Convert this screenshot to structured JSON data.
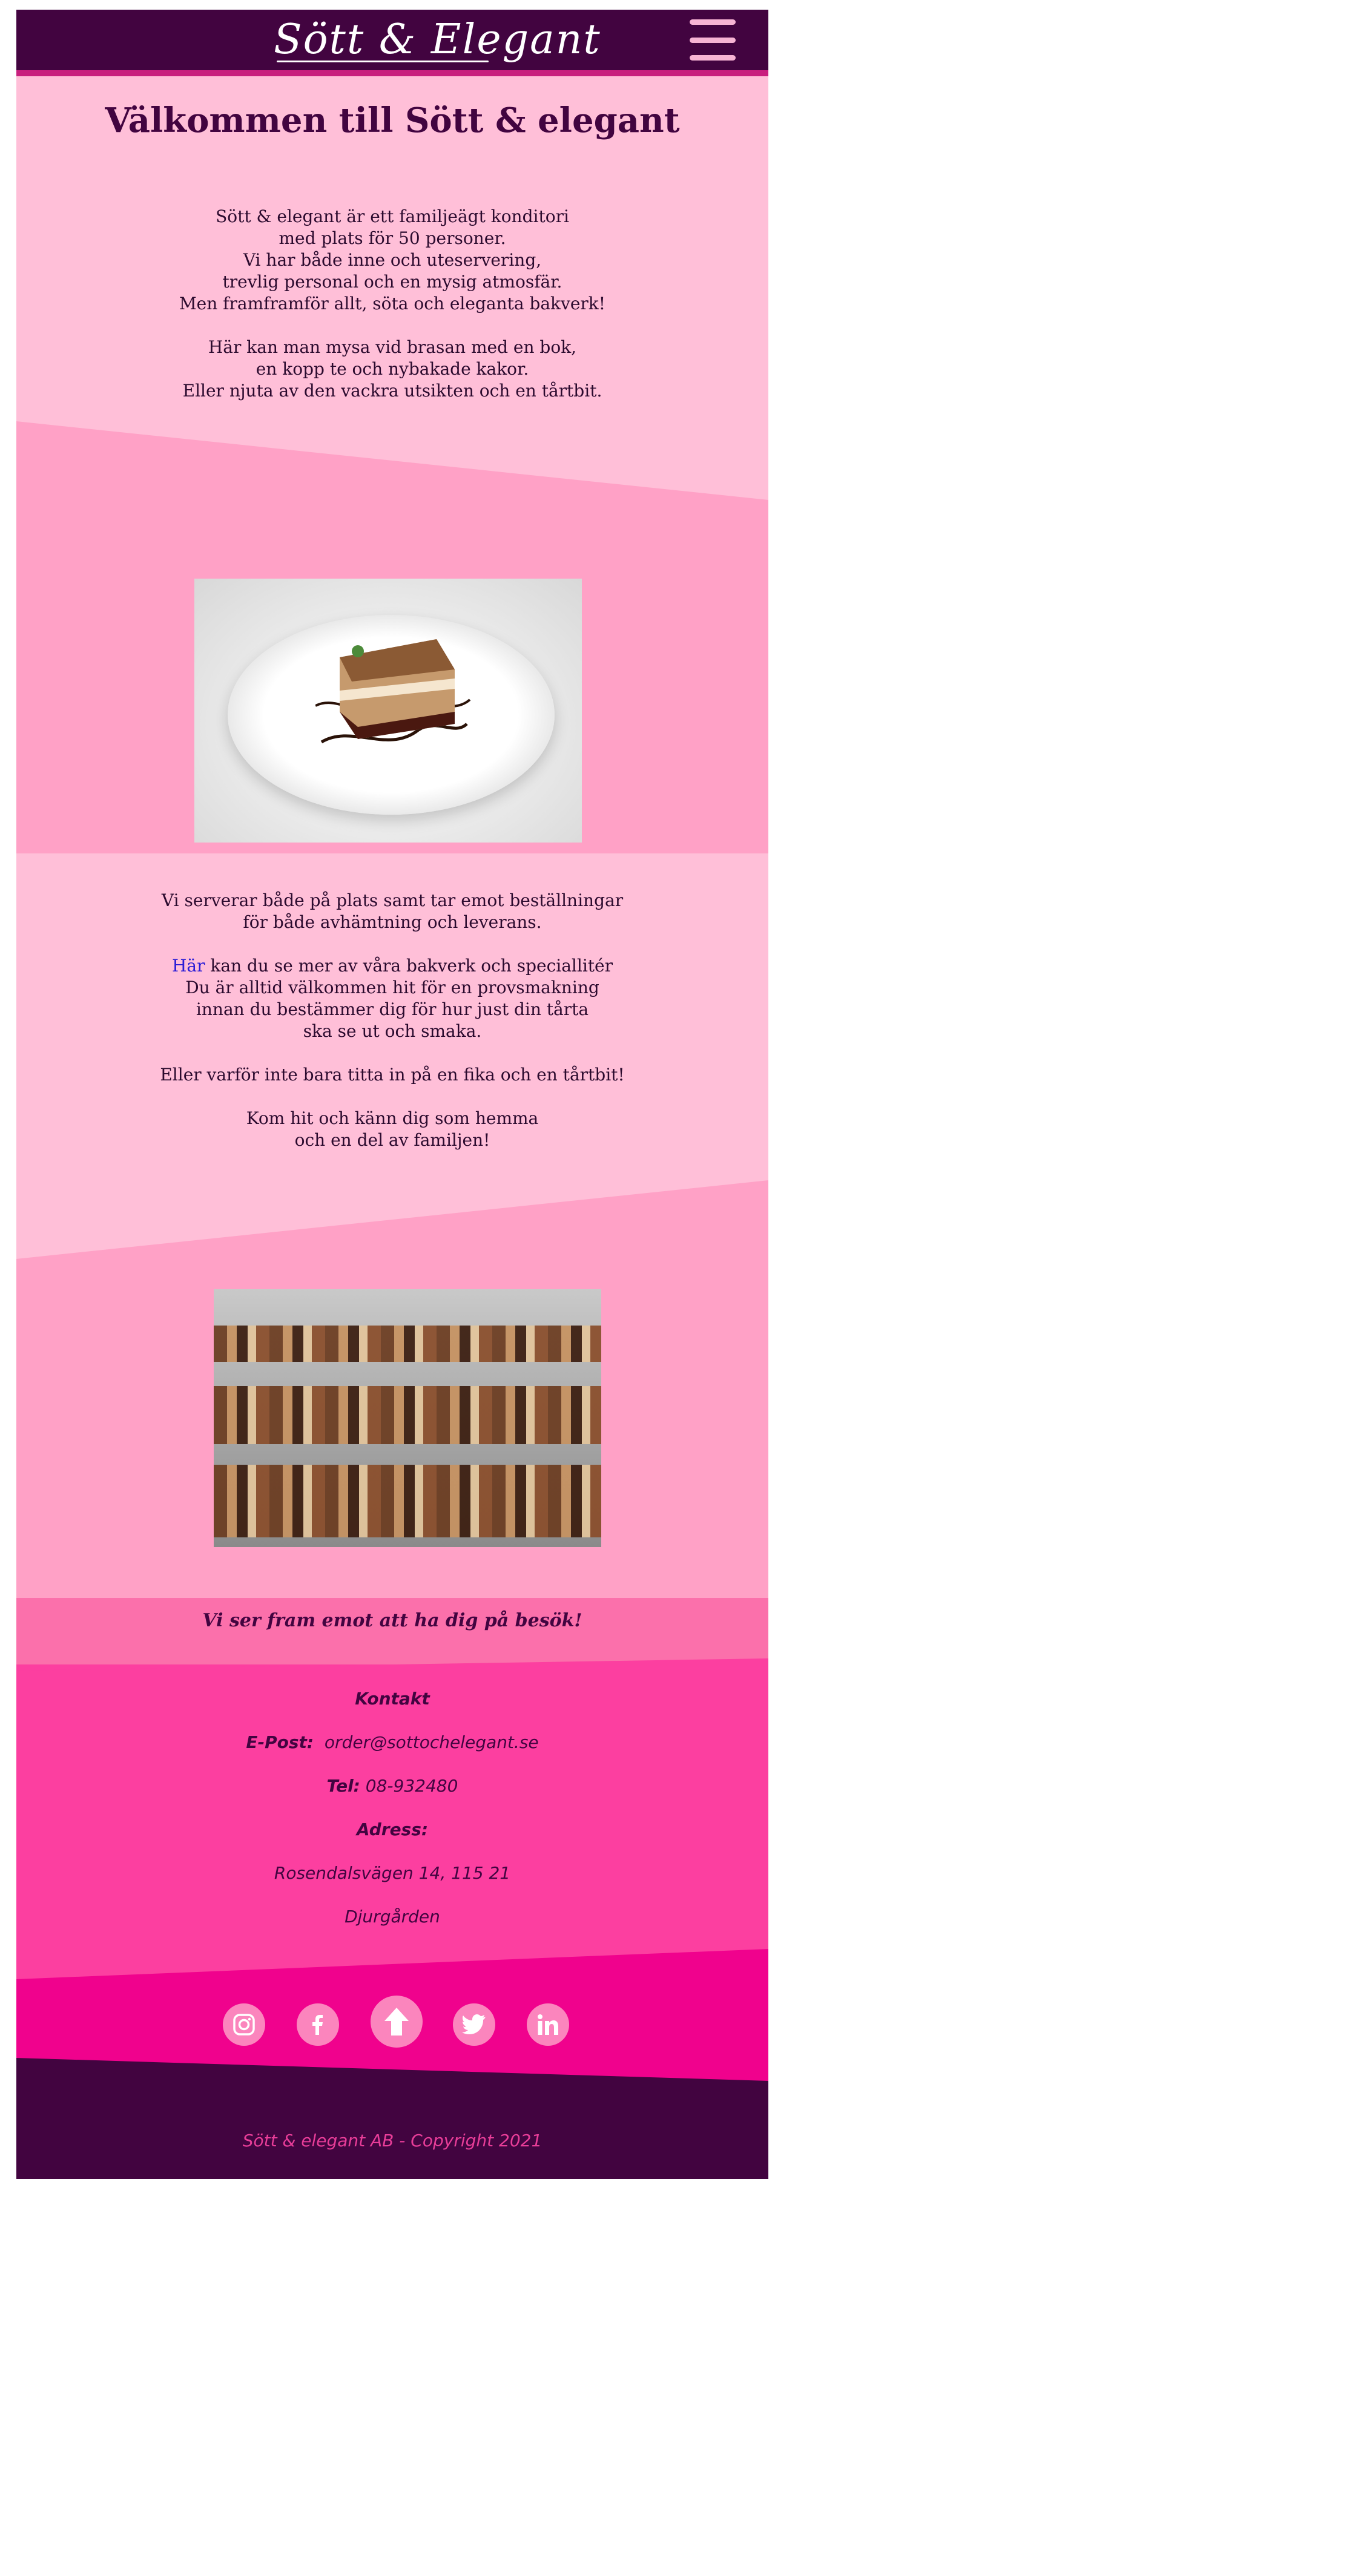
{
  "header": {
    "logo_text": "Sött & Elegant",
    "menu_icon": "hamburger-menu-icon",
    "colors": {
      "background": "#420440",
      "accent": "#c81f7e"
    }
  },
  "welcome": {
    "title": "Välkommen till Sött & elegant",
    "paragraph1": [
      "Sött & elegant är ett familjeägt konditori",
      "med plats för 50 personer.",
      "Vi har både inne och uteservering,",
      "trevlig personal och en mysig atmosfär.",
      "Men framframför allt, söta och eleganta bakverk!"
    ],
    "paragraph2": [
      "Här kan man mysa vid brasan med en bok,",
      "en kopp te och nybakade kakor.",
      "Eller njuta av den vackra utsikten och en tårtbit."
    ]
  },
  "service": {
    "lines1": [
      "Vi serverar både på plats samt tar emot beställningar",
      "för både avhämtning och leverans."
    ],
    "link_text": "Här",
    "link_line_rest": " kan du se mer av våra bakverk och speciallitér",
    "lines2": [
      "Du är alltid välkommen hit för en provsmakning",
      "innan du bestämmer dig för hur just din tårta",
      "ska se ut och smaka."
    ],
    "line3": "Eller varför inte bara titta in på en fika och en tårtbit!",
    "lines4": [
      "Kom hit och känn dig som hemma",
      "och en del av familjen!"
    ]
  },
  "visit": {
    "text": "Vi ser fram emot att ha dig på besök!"
  },
  "contact": {
    "heading": "Kontakt",
    "email_label": "E-Post:",
    "email": "order@sottochelegant.se",
    "phone_label": "Tel:",
    "phone": "08-932480",
    "address_label": "Adress:",
    "street": "Rosendalsvägen 14, 115 21",
    "area": "Djurgården"
  },
  "social": {
    "icons": [
      "instagram-icon",
      "facebook-icon",
      "scroll-to-top-icon",
      "twitter-icon",
      "linkedin-icon"
    ]
  },
  "footer": {
    "copyright": "Sött & elegant AB - Copyright 2021"
  },
  "colors": {
    "light_pink": "#ffbfd8",
    "mid_pink": "#ffa1c6",
    "hot_pink": "#fc3fa0",
    "magenta": "#f0028d",
    "plum": "#420440"
  }
}
